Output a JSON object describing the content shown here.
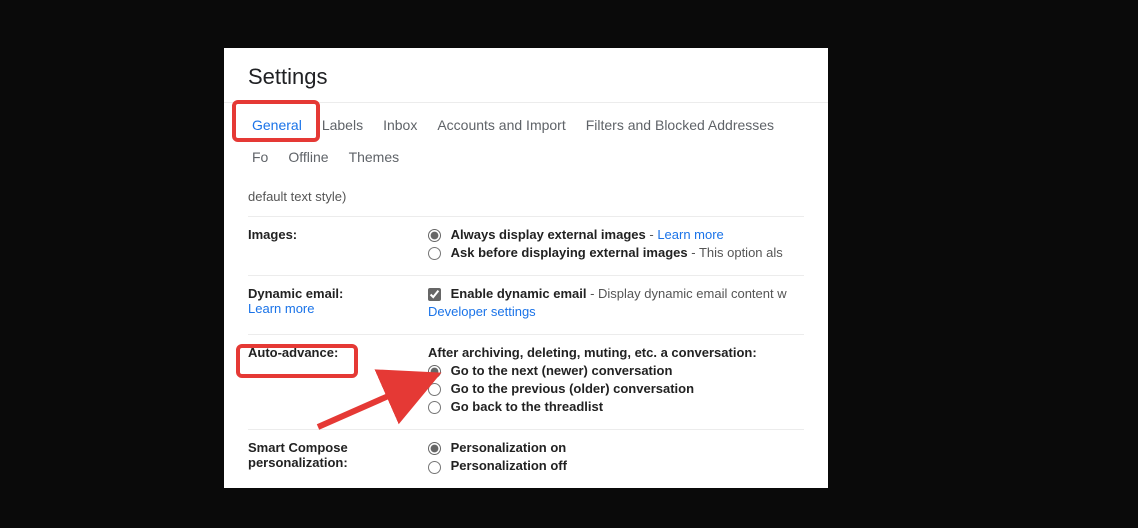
{
  "title": "Settings",
  "tabs": {
    "general": "General",
    "labels": "Labels",
    "inbox": "Inbox",
    "accounts": "Accounts and Import",
    "filters": "Filters and Blocked Addresses",
    "forward": "Fo",
    "offline": "Offline",
    "themes": "Themes"
  },
  "rows": {
    "default_text_style": "default text style)",
    "images": {
      "label": "Images:",
      "opt1": "Always display external images",
      "opt1_link": "Learn more",
      "opt2": "Ask before displaying external images",
      "opt2_tail": " - This option als"
    },
    "dynamic": {
      "label": "Dynamic email:",
      "learn": "Learn more",
      "enable": "Enable dynamic email",
      "enable_tail": " - Display dynamic email content w",
      "dev": "Developer settings"
    },
    "auto_advance": {
      "label": "Auto-advance:",
      "desc": "After archiving, deleting, muting, etc. a conversation:",
      "opt1": "Go to the next (newer) conversation",
      "opt2": "Go to the previous (older) conversation",
      "opt3": "Go back to the threadlist"
    },
    "smart_compose": {
      "label1": "Smart Compose",
      "label2": "personalization:",
      "opt1": "Personalization on",
      "opt2": "Personalization off"
    }
  }
}
